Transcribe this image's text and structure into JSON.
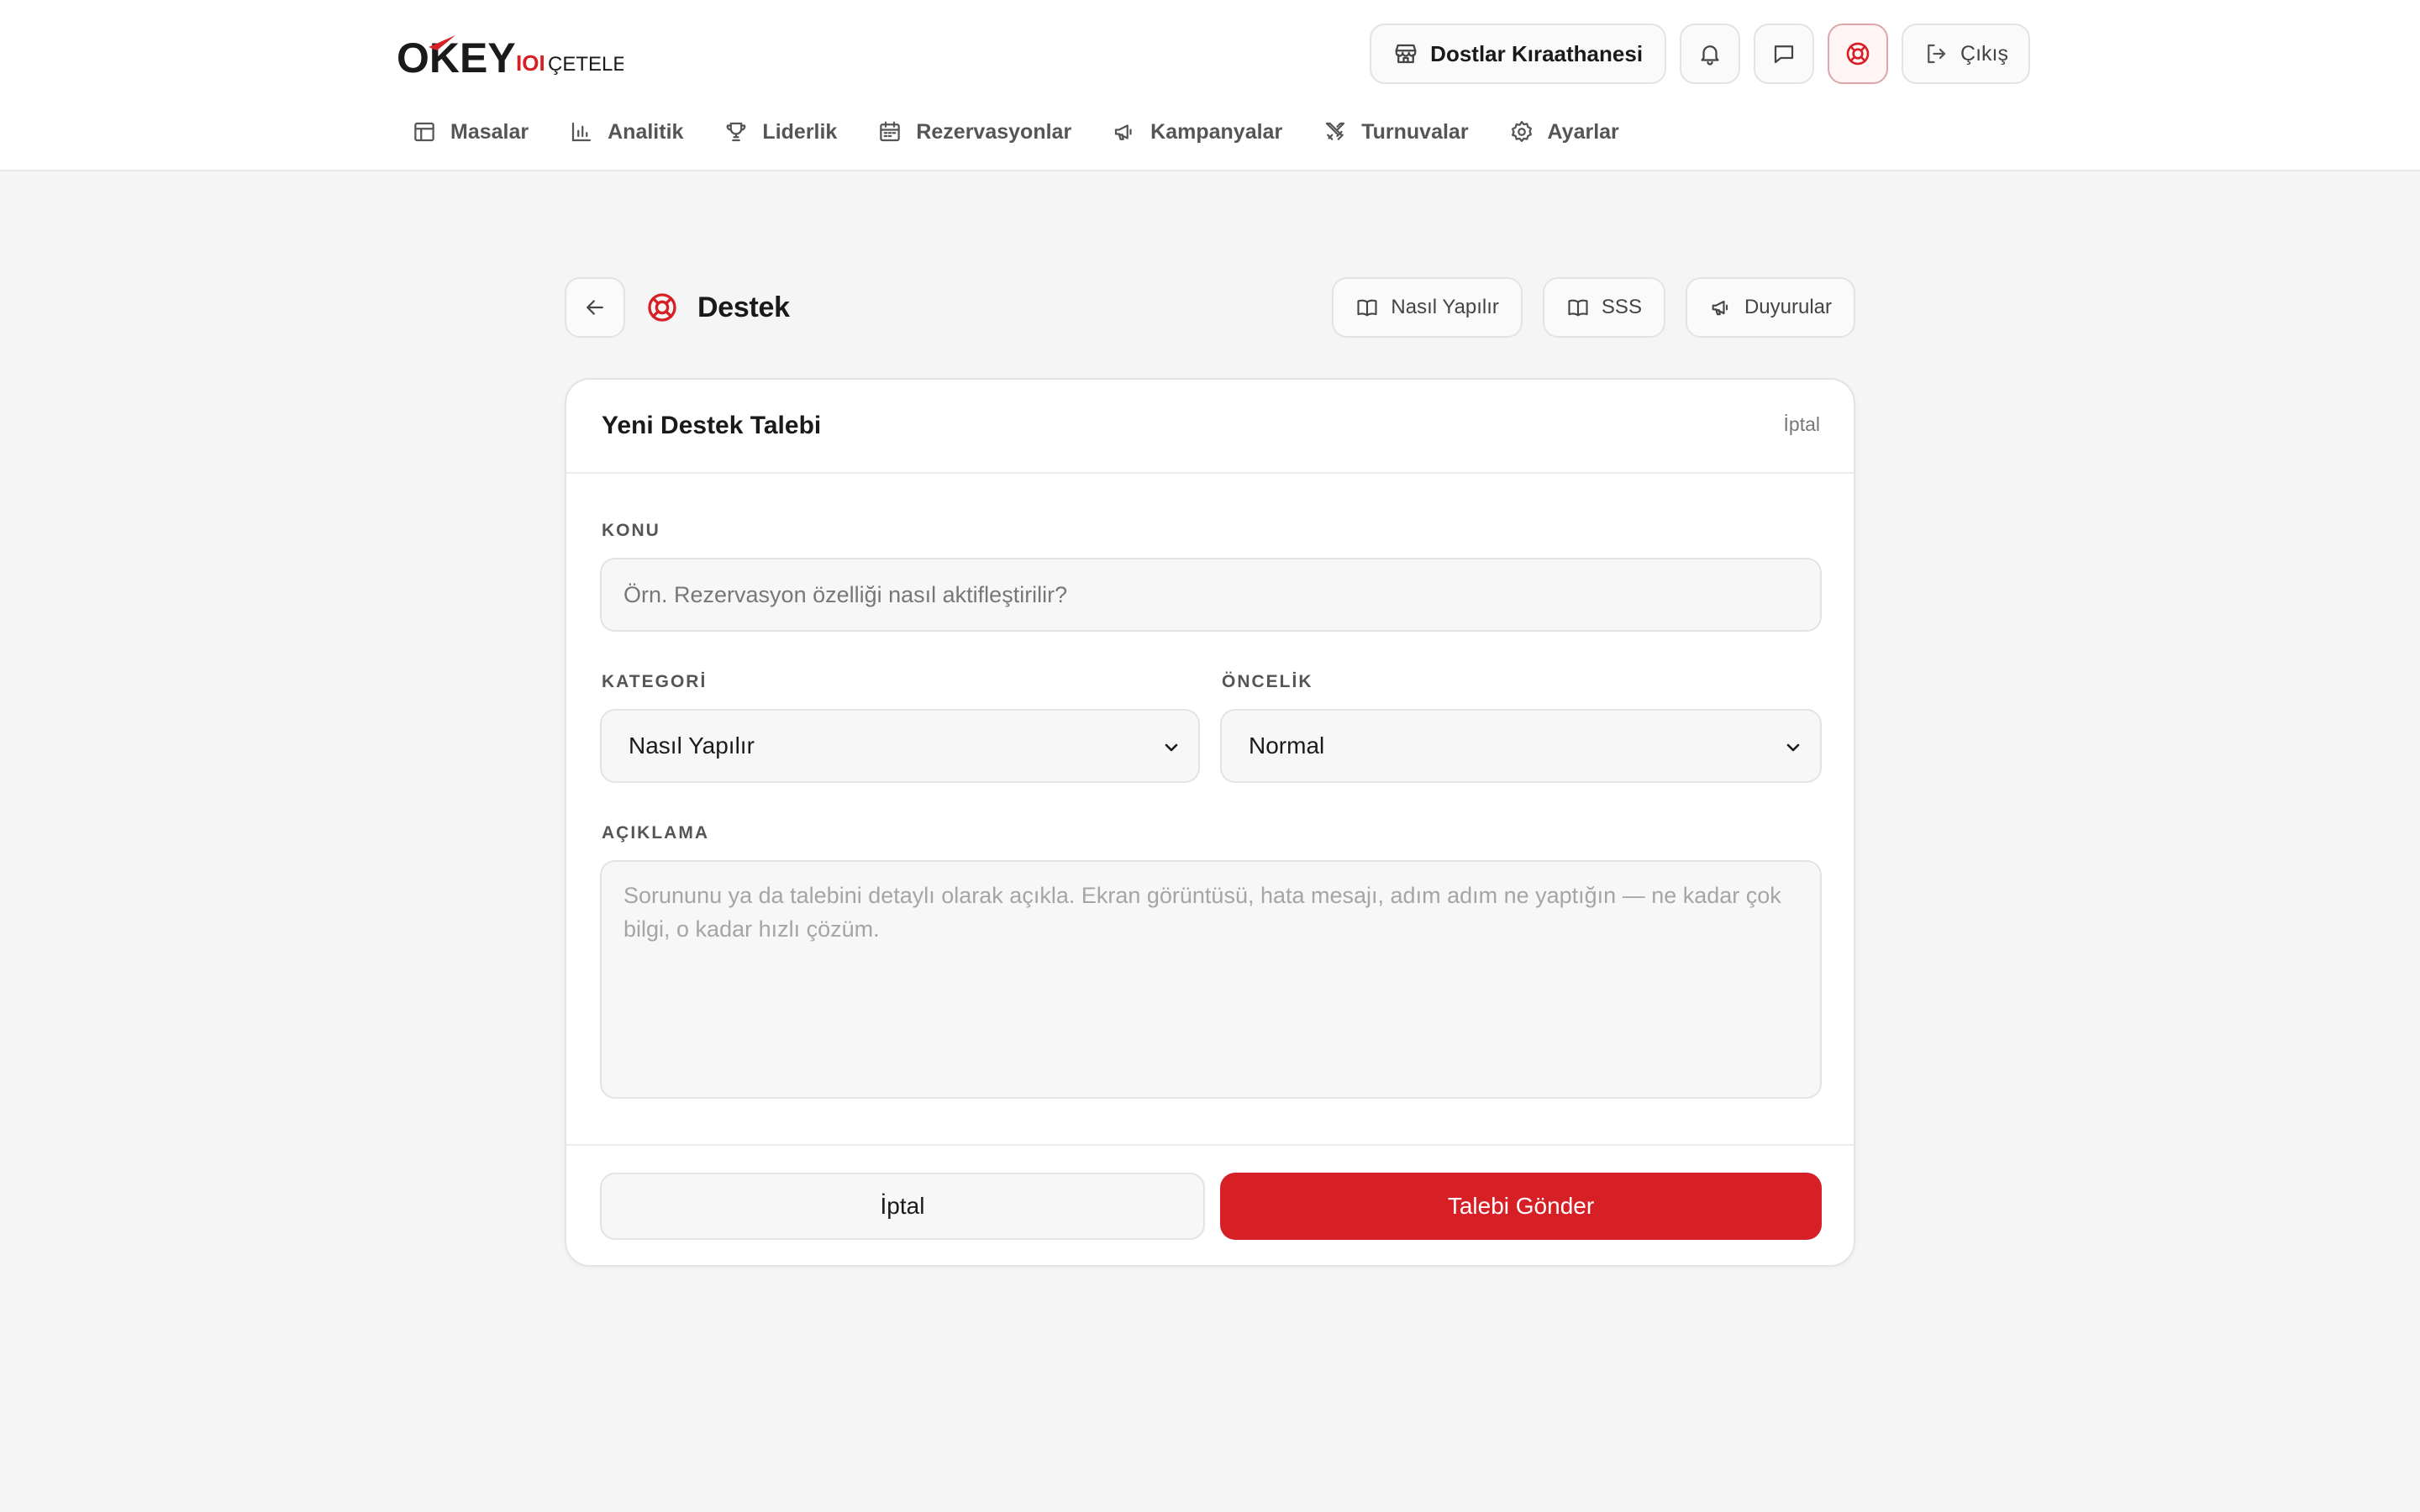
{
  "brand": {
    "logo_text": "OKEY",
    "logo_sub": "ÇETELE",
    "logo_mark": "IOI",
    "accent_color": "#d71f26"
  },
  "header": {
    "venue_label": "Dostlar Kıraathanesi",
    "venue_icon": "store-icon",
    "notifications_icon": "bell-icon",
    "messages_icon": "chat-icon",
    "support_icon": "lifebuoy-icon",
    "logout_label": "Çıkış",
    "logout_icon": "logout-icon"
  },
  "nav": {
    "items": [
      {
        "label": "Masalar",
        "icon": "table-icon"
      },
      {
        "label": "Analitik",
        "icon": "bar-chart-icon"
      },
      {
        "label": "Liderlik",
        "icon": "trophy-icon"
      },
      {
        "label": "Rezervasyonlar",
        "icon": "calendar-icon"
      },
      {
        "label": "Kampanyalar",
        "icon": "megaphone-icon"
      },
      {
        "label": "Turnuvalar",
        "icon": "swords-icon"
      },
      {
        "label": "Ayarlar",
        "icon": "gear-icon"
      }
    ]
  },
  "page": {
    "title": "Destek",
    "title_icon": "lifebuoy-icon",
    "quick_links": [
      {
        "label": "Nasıl Yapılır",
        "icon": "book-icon"
      },
      {
        "label": "SSS",
        "icon": "book-icon"
      },
      {
        "label": "Duyurular",
        "icon": "megaphone-icon"
      }
    ]
  },
  "form": {
    "title": "Yeni Destek Talebi",
    "header_cancel": "İptal",
    "subject_label": "KONU",
    "subject_placeholder": "Örn. Rezervasyon özelliği nasıl aktifleştirilir?",
    "category_label": "KATEGORİ",
    "category_value": "Nasıl Yapılır",
    "priority_label": "ÖNCELİK",
    "priority_value": "Normal",
    "description_label": "AÇIKLAMA",
    "description_placeholder": "Sorununu ya da talebini detaylı olarak açıkla. Ekran görüntüsü, hata mesajı, adım adım ne yaptığın — ne kadar çok bilgi, o kadar hızlı çözüm.",
    "cancel_button": "İptal",
    "submit_button": "Talebi Gönder"
  }
}
